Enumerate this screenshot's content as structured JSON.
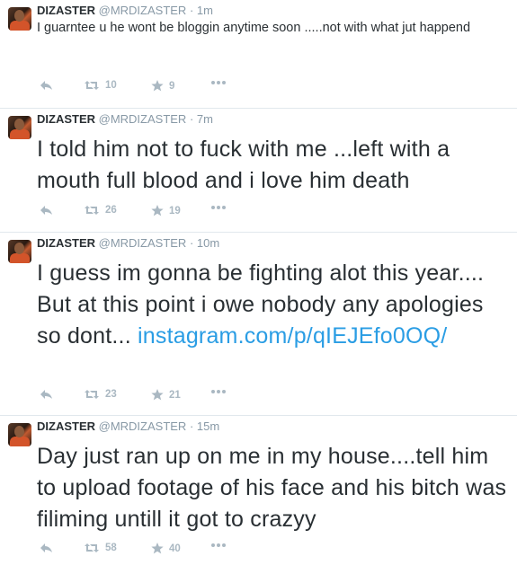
{
  "tweets": [
    {
      "name": "DIZASTER",
      "handle": "@MRDIZASTER",
      "dot": "·",
      "time": "1m",
      "text": "I guarntee u he wont be bloggin anytime soon .....not with what jut happend",
      "link": "",
      "retweets": "10",
      "favorites": "9"
    },
    {
      "name": "DIZASTER",
      "handle": "@MRDIZASTER",
      "dot": "·",
      "time": "7m",
      "text": "I told him not to fuck with me ...left with a mouth full blood and i love him death",
      "link": "",
      "retweets": "26",
      "favorites": "19"
    },
    {
      "name": "DIZASTER",
      "handle": "@MRDIZASTER",
      "dot": "·",
      "time": "10m",
      "text": "I guess im gonna be fighting alot this year.... But at this point i owe nobody any apologies so dont...",
      "link": "instagram.com/p/qIEJEfo0OQ/",
      "retweets": "23",
      "favorites": "21"
    },
    {
      "name": "DIZASTER",
      "handle": "@MRDIZASTER",
      "dot": "·",
      "time": "15m",
      "text": "Day just ran up on me in my house....tell him to upload footage of his face and his bitch was filiming untill it got to crazyy",
      "link": "",
      "retweets": "58",
      "favorites": "40"
    }
  ],
  "icons": {
    "reply": "reply-icon",
    "retweet": "retweet-icon",
    "favorite": "star-icon",
    "more": "more-icon"
  },
  "colors": {
    "link": "#2a9de4",
    "muted": "#8899a6",
    "action": "#aab8c2",
    "text": "#292f33"
  }
}
